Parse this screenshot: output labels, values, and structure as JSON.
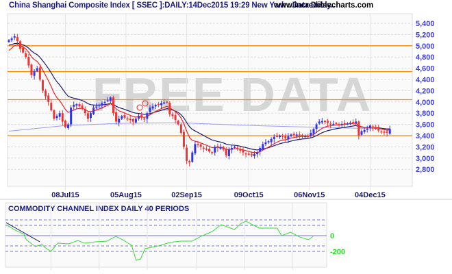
{
  "header": {
    "title": "China Shanghai Composite Index [ SSEC ]:DAILY:14Dec2015 19:29 New York : Data Delay..",
    "site": "www.incrediblecharts.com"
  },
  "watermark": "FREE DATA",
  "chart_data": [
    {
      "type": "candlestick",
      "title": "China Shanghai Composite Index [ SSEC ]",
      "ylim": [
        2650,
        5450
      ],
      "y_ticks": [
        "5,400",
        "5,200",
        "5,000",
        "4,800",
        "4,600",
        "4,400",
        "4,200",
        "4,000",
        "3,800",
        "3,600",
        "3,400",
        "3,200",
        "3,000",
        "2,800"
      ],
      "y_tick_values": [
        5400,
        5200,
        5000,
        4800,
        4600,
        4400,
        4200,
        4000,
        3800,
        3600,
        3400,
        3200,
        3000,
        2800
      ],
      "x_ticks": [
        {
          "label": "08Jul15",
          "index": 20
        },
        {
          "label": "05Aug15",
          "index": 41.5
        },
        {
          "label": "02Sep15",
          "index": 63
        },
        {
          "label": "09Oct15",
          "index": 85
        },
        {
          "label": "06Nov15",
          "index": 106.5
        },
        {
          "label": "04Dec15",
          "index": 128
        }
      ],
      "support_resistance_lines": [
        5000,
        4540,
        4040,
        3400
      ],
      "close": [
        5100,
        5130,
        5170,
        5080,
        4950,
        4880,
        4800,
        4650,
        4480,
        4550,
        4600,
        4400,
        4200,
        4100,
        4000,
        3850,
        3700,
        3750,
        3800,
        3650,
        3550,
        3600,
        3900,
        3950,
        3960,
        3920,
        3880,
        3800,
        3700,
        3800,
        3900,
        3920,
        3950,
        3980,
        4000,
        4030,
        4080,
        3800,
        3650,
        3700,
        3750,
        3720,
        3700,
        3680,
        3650,
        3700,
        3750,
        3720,
        3700,
        3800,
        3900,
        3920,
        3950,
        3960,
        3980,
        3990,
        4000,
        3780,
        3750,
        3680,
        3600,
        3450,
        3200,
        2950,
        2920,
        3100,
        3250,
        3230,
        3200,
        3170,
        3150,
        3120,
        3100,
        3200,
        3180,
        3200,
        3150,
        3050,
        3150,
        3180,
        3200,
        3160,
        3130,
        3100,
        3080,
        3060,
        3050,
        3070,
        3100,
        3180,
        3250,
        3280,
        3300,
        3340,
        3380,
        3390,
        3400,
        3380,
        3350,
        3390,
        3420,
        3410,
        3420,
        3400,
        3400,
        3390,
        3380,
        3450,
        3520,
        3600,
        3650,
        3660,
        3650,
        3630,
        3600,
        3610,
        3620,
        3600,
        3610,
        3620,
        3620,
        3630,
        3640,
        3650,
        3400,
        3480,
        3500,
        3520,
        3580,
        3550,
        3520,
        3490,
        3470,
        3460,
        3450,
        3520
      ],
      "ma_long": [
        [
          0,
          3480
        ],
        [
          20,
          3580
        ],
        [
          40,
          3620
        ],
        [
          60,
          3630
        ],
        [
          80,
          3590
        ],
        [
          100,
          3560
        ],
        [
          120,
          3535
        ],
        [
          135,
          3525
        ]
      ],
      "colors": {
        "up": "#3333ee",
        "down": "#ee3333",
        "ema_short": "#ee2222",
        "ema_long": "#1a1a6c",
        "ma_long": "#9999ff",
        "levels": "#ff8800"
      }
    },
    {
      "type": "line",
      "title": "COMMODITY CHANNEL INDEX DAILY 40 PERIODS",
      "ylim": [
        -350,
        280
      ],
      "y_ticks": [
        "0",
        "-200"
      ],
      "y_tick_values": [
        0,
        -200
      ],
      "levels_solid": [
        0
      ],
      "levels_dashed": [
        200,
        130,
        -130,
        -200
      ],
      "cci": [
        [
          0,
          139
        ],
        [
          4,
          70
        ],
        [
          8,
          17
        ],
        [
          9,
          -52
        ],
        [
          13,
          -139
        ],
        [
          16,
          -113
        ],
        [
          18,
          -165
        ],
        [
          20,
          -200
        ],
        [
          23,
          -96
        ],
        [
          28,
          -104
        ],
        [
          32,
          -61
        ],
        [
          35,
          -96
        ],
        [
          40,
          -78
        ],
        [
          45,
          -70
        ],
        [
          49,
          -9
        ],
        [
          52,
          -52
        ],
        [
          54,
          -87
        ],
        [
          56,
          -122
        ],
        [
          58,
          -313
        ],
        [
          60,
          -296
        ],
        [
          62,
          -165
        ],
        [
          68,
          -130
        ],
        [
          72,
          -96
        ],
        [
          75,
          -78
        ],
        [
          78,
          -70
        ],
        [
          83,
          -70
        ],
        [
          87,
          -9
        ],
        [
          92,
          52
        ],
        [
          96,
          139
        ],
        [
          102,
          78
        ],
        [
          105,
          157
        ],
        [
          107,
          183
        ],
        [
          113,
          96
        ],
        [
          117,
          96
        ],
        [
          121,
          96
        ],
        [
          123,
          0
        ],
        [
          127,
          43
        ],
        [
          131,
          -17
        ],
        [
          135,
          -52
        ],
        [
          137,
          -10
        ]
      ],
      "trendline": [
        [
          0,
          165
        ],
        [
          15,
          -78
        ]
      ],
      "colors": {
        "line": "#33dd33",
        "trendline": "#1a1a6c"
      }
    }
  ]
}
